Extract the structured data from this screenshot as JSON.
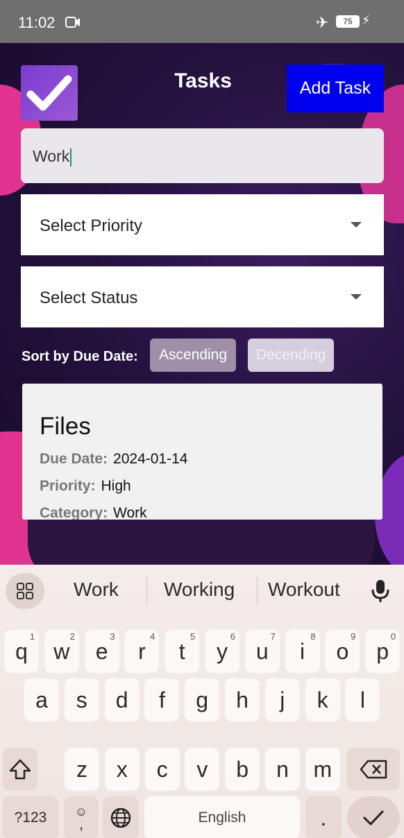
{
  "status_bar": {
    "time": "11:02",
    "battery": "75"
  },
  "app": {
    "title": "Tasks",
    "add_task_label": "Add Task",
    "search_value": "Work",
    "priority_placeholder": "Select Priority",
    "status_placeholder": "Select Status",
    "sort_label": "Sort by Due Date:",
    "sort_ascending": "Ascending",
    "sort_descending": "Decending",
    "task": {
      "name": "Files",
      "due_date_label": "Due Date:",
      "due_date": "2024-01-14",
      "priority_label": "Priority:",
      "priority": "High",
      "category_label": "Category:",
      "category": "Work"
    }
  },
  "keyboard": {
    "suggestions": [
      "Work",
      "Working",
      "Workout"
    ],
    "row1": [
      {
        "key": "q",
        "sup": "1"
      },
      {
        "key": "w",
        "sup": "2"
      },
      {
        "key": "e",
        "sup": "3"
      },
      {
        "key": "r",
        "sup": "4"
      },
      {
        "key": "t",
        "sup": "5"
      },
      {
        "key": "y",
        "sup": "6"
      },
      {
        "key": "u",
        "sup": "7"
      },
      {
        "key": "i",
        "sup": "8"
      },
      {
        "key": "o",
        "sup": "9"
      },
      {
        "key": "p",
        "sup": "0"
      }
    ],
    "row2": [
      "a",
      "s",
      "d",
      "f",
      "g",
      "h",
      "j",
      "k",
      "l"
    ],
    "row3": [
      "z",
      "x",
      "c",
      "v",
      "b",
      "n",
      "m"
    ],
    "symbols_label": "?123",
    "comma_label": ",",
    "space_label": "English",
    "period_label": "."
  }
}
